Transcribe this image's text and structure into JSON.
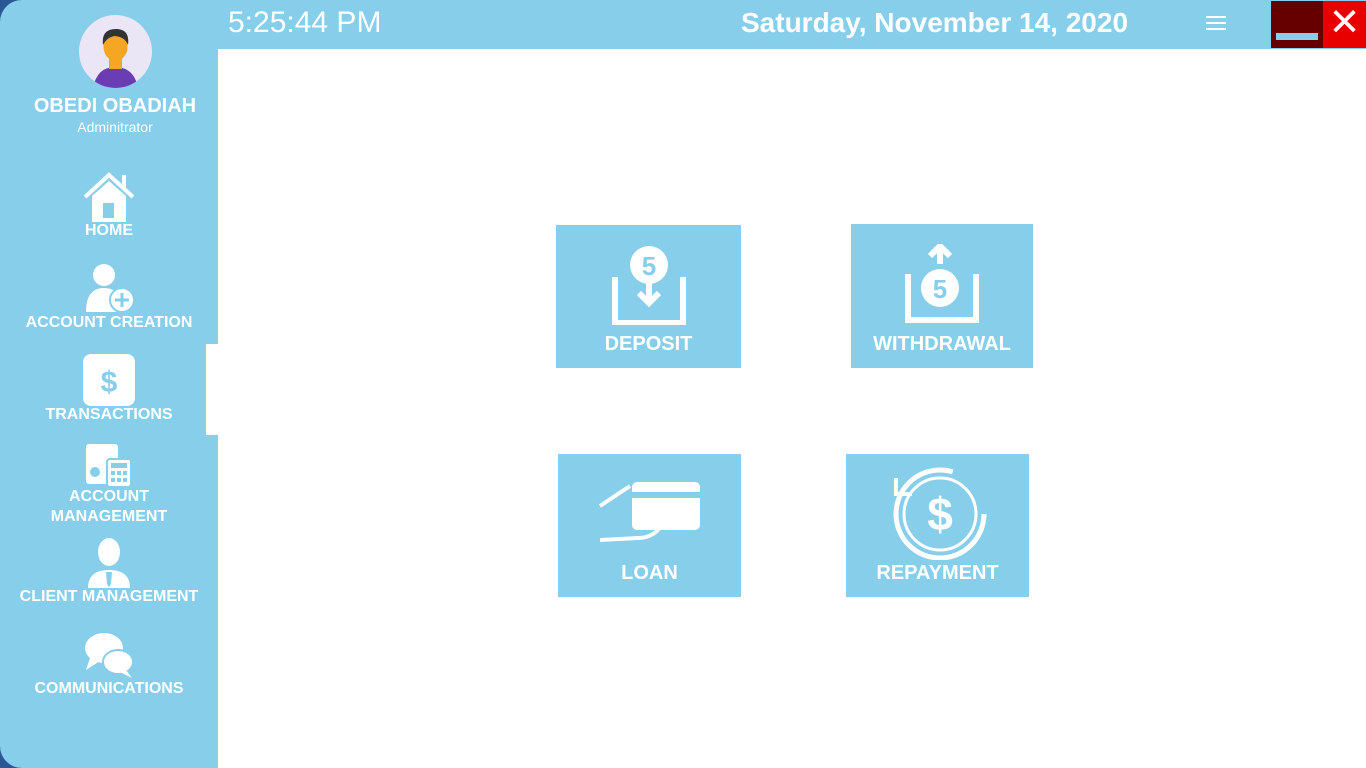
{
  "header": {
    "time": "5:25:44 PM",
    "date": "Saturday, November 14, 2020"
  },
  "user": {
    "name": "OBEDI OBADIAH",
    "role": "Adminitrator"
  },
  "sidebar": {
    "items": [
      {
        "label": "HOME",
        "icon": "home-icon"
      },
      {
        "label": "ACCOUNT CREATION",
        "icon": "add-user-icon"
      },
      {
        "label": "TRANSACTIONS",
        "icon": "dollar-icon",
        "selected": true
      },
      {
        "label": "ACCOUNT MANAGEMENT",
        "icon": "calculator-icon"
      },
      {
        "label": "CLIENT MANAGEMENT",
        "icon": "businessman-icon"
      },
      {
        "label": "COMMUNICATIONS",
        "icon": "chat-icon"
      }
    ]
  },
  "tiles": [
    {
      "label": "DEPOSIT"
    },
    {
      "label": "WITHDRAWAL"
    },
    {
      "label": "LOAN"
    },
    {
      "label": "REPAYMENT"
    }
  ],
  "colors": {
    "accent": "#87ceeb",
    "minimize": "#660000",
    "close": "#e80000"
  }
}
